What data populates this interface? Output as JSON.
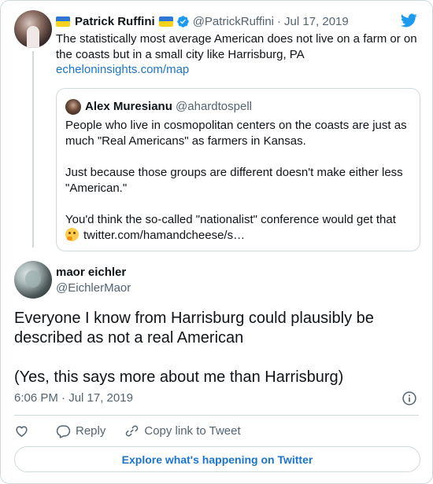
{
  "parent_tweet": {
    "author_name": "Patrick Ruffini",
    "author_handle": "@PatrickRuffini",
    "date": "Jul 17, 2019",
    "text": "The statistically most average American does not live on a farm or on the coasts but in a small city like Harrisburg, PA",
    "link": "echeloninsights.com/map"
  },
  "quoted_tweet": {
    "author_name": "Alex Muresianu",
    "author_handle": "@ahardtospell",
    "paragraphs": [
      "People who live in cosmopolitan centers on the coasts are just as much \"Real Americans\" as farmers in Kansas.",
      "Just because those groups are different doesn't make either less \"American.\"",
      "You'd think the so-called \"nationalist\" conference would get that"
    ],
    "link": "twitter.com/hamandcheese/s…"
  },
  "main_tweet": {
    "author_name": "maor eichler",
    "author_handle": "@EichlerMaor",
    "paragraphs": [
      "Everyone I know from Harrisburg could plausibly be described as not a real American",
      "(Yes, this says more about me than Harrisburg)"
    ],
    "timestamp": "6:06 PM · Jul 17, 2019"
  },
  "actions": {
    "reply_label": "Reply",
    "copy_link_label": "Copy link to Tweet"
  },
  "explore_label": "Explore what's happening on Twitter",
  "icons": {
    "verified": "verified-badge-icon",
    "bird": "twitter-bird-icon",
    "flag": "ukraine-flag-icon",
    "emoji": "thinking-face-emoji",
    "like": "heart-icon",
    "reply": "speech-bubble-icon",
    "copy": "link-icon",
    "info": "info-icon"
  },
  "colors": {
    "accent": "#1d9bf0",
    "link": "#1b74c9",
    "muted": "#536471",
    "border": "#cfd9de"
  }
}
